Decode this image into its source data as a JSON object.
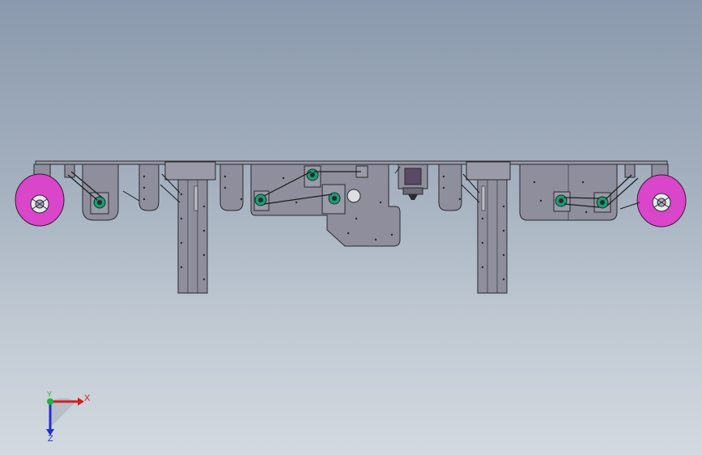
{
  "viewport": {
    "background_top": "#8a99ad",
    "background_bottom": "#d3d9e0"
  },
  "model": {
    "plate_color": "#8e8e9c",
    "edge_color": "#2a2a30",
    "wheel_color": "#d946c9",
    "pulley_color": "#1f9a73",
    "motor_color": "#5a4a66"
  },
  "triad": {
    "x_label": "X",
    "y_label": "Y",
    "z_label": "Z",
    "x_color": "#d02020",
    "y_color": "#20b040",
    "z_color": "#2030d0"
  }
}
